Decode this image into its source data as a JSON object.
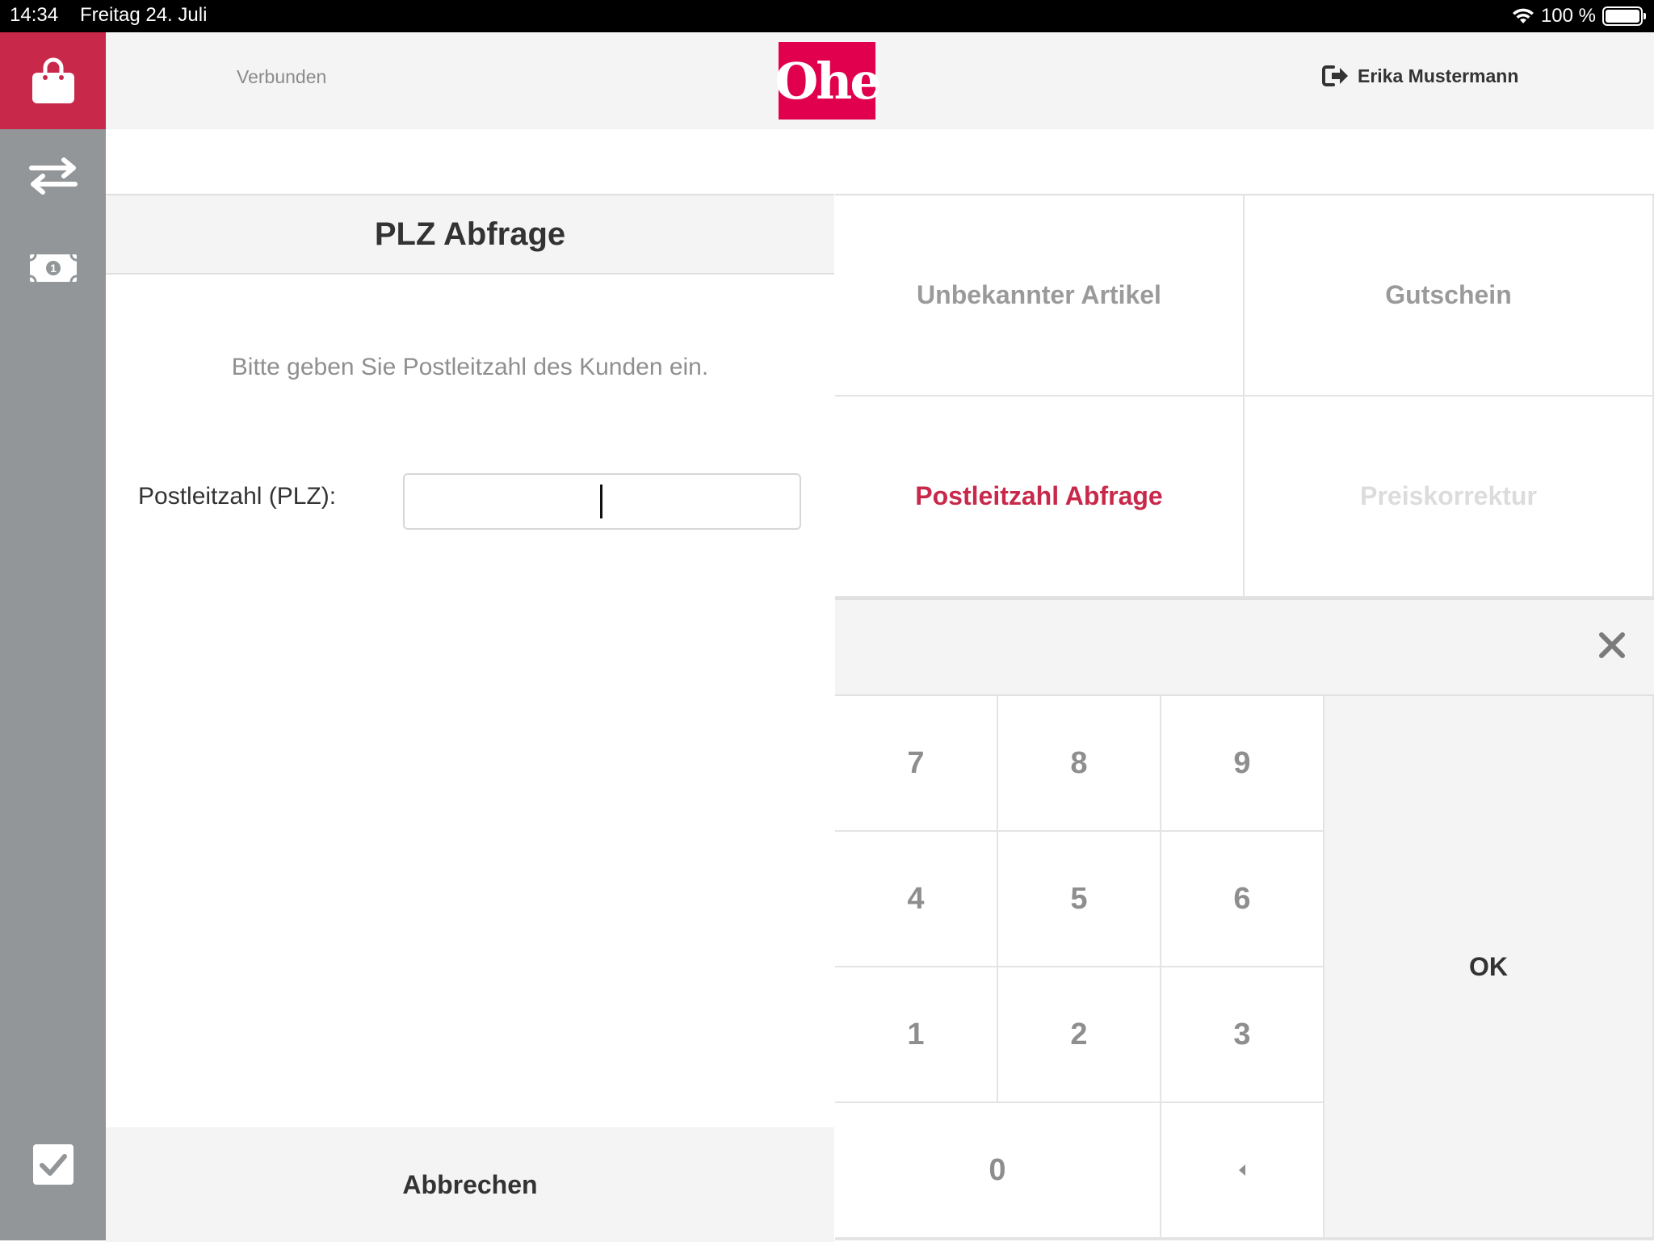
{
  "status_bar": {
    "time": "14:34",
    "date": "Freitag 24. Juli",
    "battery": "100 %"
  },
  "header": {
    "connection_status": "Verbunden",
    "logo_text": "Ohe",
    "user_name": "Erika Mustermann"
  },
  "sidebar": {
    "items": [
      "shopping-bag-icon",
      "transfer-icon",
      "cash-icon",
      "checkbox-icon"
    ]
  },
  "dialog": {
    "title": "PLZ Abfrage",
    "prompt": "Bitte geben Sie Postleitzahl des Kunden ein.",
    "plz_label": "Postleitzahl (PLZ):",
    "plz_value": "",
    "cancel_label": "Abbrechen"
  },
  "functions": [
    {
      "label": "Unbekannter Artikel",
      "state": "normal"
    },
    {
      "label": "Gutschein",
      "state": "normal"
    },
    {
      "label": "Postleitzahl Abfrage",
      "state": "active"
    },
    {
      "label": "Preiskorrektur",
      "state": "disabled"
    }
  ],
  "numpad": {
    "display": "",
    "keys": [
      "7",
      "8",
      "9",
      "4",
      "5",
      "6",
      "1",
      "2",
      "3",
      "0"
    ],
    "ok_label": "OK"
  },
  "colors": {
    "accent": "#c8284a",
    "brand": "#e0004d",
    "sidebar": "#939698",
    "panel_bg": "#f5f4f5"
  }
}
